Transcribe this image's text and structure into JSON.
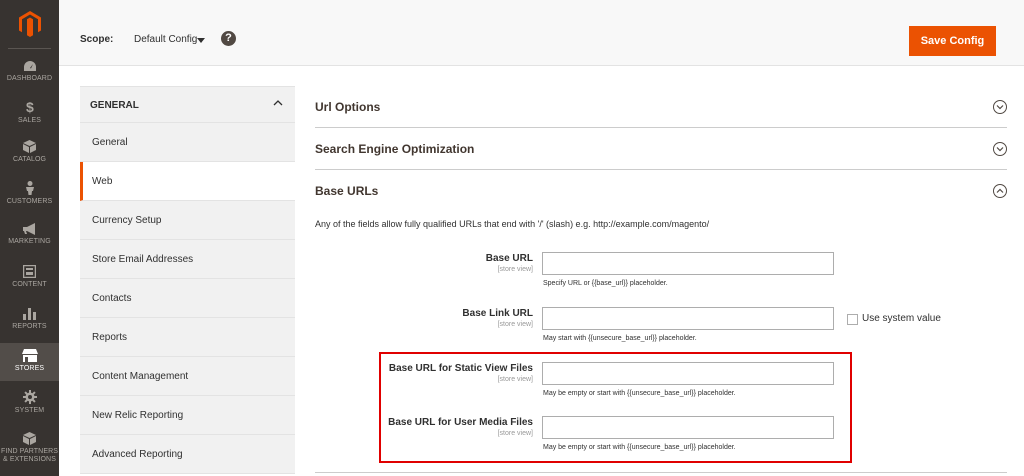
{
  "nav": {
    "items": [
      {
        "label": "DASHBOARD",
        "icon": "dashboard-icon"
      },
      {
        "label": "SALES",
        "icon": "dollar-icon"
      },
      {
        "label": "CATALOG",
        "icon": "box-icon"
      },
      {
        "label": "CUSTOMERS",
        "icon": "person-icon"
      },
      {
        "label": "MARKETING",
        "icon": "megaphone-icon"
      },
      {
        "label": "CONTENT",
        "icon": "content-icon"
      },
      {
        "label": "REPORTS",
        "icon": "bar-chart-icon"
      },
      {
        "label": "STORES",
        "icon": "store-icon"
      },
      {
        "label": "SYSTEM",
        "icon": "gear-icon"
      },
      {
        "label": "FIND PARTNERS",
        "label2": "& EXTENSIONS",
        "icon": "cube-icon"
      }
    ],
    "active": "STORES",
    "accent": "#eb5202"
  },
  "scope": {
    "label": "Scope:",
    "value": "Default Config",
    "help": "?"
  },
  "toolbar": {
    "save_label": "Save Config"
  },
  "config_tabs": {
    "heading": "GENERAL",
    "items": [
      "General",
      "Web",
      "Currency Setup",
      "Store Email Addresses",
      "Contacts",
      "Reports",
      "Content Management",
      "New Relic Reporting",
      "Advanced Reporting"
    ],
    "active": "Web"
  },
  "sections": [
    {
      "title": "Url Options",
      "state": "collapsed"
    },
    {
      "title": "Search Engine Optimization",
      "state": "collapsed"
    },
    {
      "title": "Base URLs",
      "state": "expanded"
    }
  ],
  "base_urls": {
    "description": "Any of the fields allow fully qualified URLs that end with '/' (slash) e.g. http://example.com/magento/",
    "fields": [
      {
        "label": "Base URL",
        "scope": "[store view]",
        "value": "",
        "note": "Specify URL or {{base_url}} placeholder."
      },
      {
        "label": "Base Link URL",
        "scope": "[store view]",
        "value": "",
        "note": "May start with {{unsecure_base_url}} placeholder."
      },
      {
        "label": "Base URL for Static View Files",
        "scope": "[store view]",
        "value": "",
        "note": "May be empty or start with {{unsecure_base_url}} placeholder."
      },
      {
        "label": "Base URL for User Media Files",
        "scope": "[store view]",
        "value": "",
        "note": "May be empty or start with {{unsecure_base_url}} placeholder."
      }
    ],
    "use_system_value_label": "Use system value"
  }
}
